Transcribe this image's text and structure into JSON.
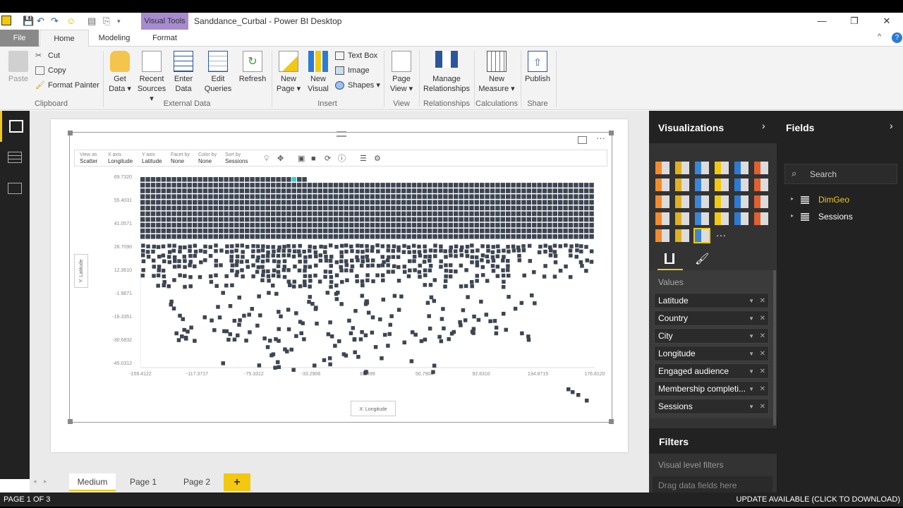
{
  "window": {
    "title": "Sanddance_Curbal - Power BI Desktop",
    "context_tab": "Visual Tools",
    "minimize": "—",
    "restore": "❐",
    "close": "✕"
  },
  "tabs": {
    "file": "File",
    "home": "Home",
    "modeling": "Modeling",
    "format": "Format"
  },
  "ribbon": {
    "paste": "Paste",
    "cut": "Cut",
    "copy": "Copy",
    "format_painter": "Format Painter",
    "clipboard_group": "Clipboard",
    "get_data": [
      "Get",
      "Data ▾"
    ],
    "recent_sources": [
      "Recent",
      "Sources ▾"
    ],
    "enter_data": [
      "Enter",
      "Data"
    ],
    "edit_queries": [
      "Edit",
      "Queries"
    ],
    "refresh": "Refresh",
    "external_group": "External Data",
    "new_page": [
      "New",
      "Page ▾"
    ],
    "new_visual": [
      "New",
      "Visual"
    ],
    "text_box": "Text Box",
    "image": "Image",
    "shapes": "Shapes ▾",
    "insert_group": "Insert",
    "page_view": [
      "Page",
      "View ▾"
    ],
    "view_group": "View",
    "manage_relationships": [
      "Manage",
      "Relationships"
    ],
    "relationships_group": "Relationships",
    "new_measure": [
      "New",
      "Measure ▾"
    ],
    "calculations_group": "Calculations",
    "publish": "Publish",
    "share_group": "Share",
    "accent": "#2b579a"
  },
  "sanddance_toolbar": [
    {
      "label": "View as",
      "value": "Scatter"
    },
    {
      "label": "X axis",
      "value": "Longitude"
    },
    {
      "label": "Y axis",
      "value": "Latitude"
    },
    {
      "label": "Facet by",
      "value": "None"
    },
    {
      "label": "Color by",
      "value": "None"
    },
    {
      "label": "Sort by",
      "value": "Sessions"
    }
  ],
  "chart_data": {
    "type": "scatter",
    "xlabel": "X: Longitude",
    "ylabel": "Y: Latitude",
    "x_ticks": [
      "-159.4122",
      "-117.3717",
      "-75.3312",
      "-33.2906",
      "8.7499",
      "50.7904",
      "92.8310",
      "134.8715",
      "176.8120"
    ],
    "y_ticks": [
      "69.7320",
      "55.4031",
      "41.0571",
      "26.7090",
      "12.3610",
      "-1.9871",
      "-16.3351",
      "-30.6832",
      "-45.0312"
    ],
    "xlim": [
      -159.4122,
      176.812
    ],
    "ylim": [
      -45.0312,
      69.732
    ],
    "marker_color": "#3d4552",
    "highlight_color": "#32d0d8"
  },
  "page_tabs": [
    "Medium",
    "Page 1",
    "Page 2"
  ],
  "add_page": "+",
  "status": {
    "page": "PAGE 1 OF 3",
    "update": "UPDATE AVAILABLE (CLICK TO DOWNLOAD)"
  },
  "visualizations": {
    "title": "Visualizations",
    "values_label": "Values",
    "fields": [
      "Latitude",
      "Country",
      "City",
      "Longitude",
      "Engaged audience",
      "Membership completi...",
      "Sessions"
    ],
    "filters_title": "Filters",
    "visual_level_filters": "Visual level filters",
    "drag_hint": "Drag data fields here"
  },
  "fields_pane": {
    "title": "Fields",
    "search_placeholder": "Search",
    "tables": [
      {
        "name": "DimGeo",
        "color": "#f2c811"
      },
      {
        "name": "Sessions",
        "color": "#ffffff"
      }
    ]
  }
}
